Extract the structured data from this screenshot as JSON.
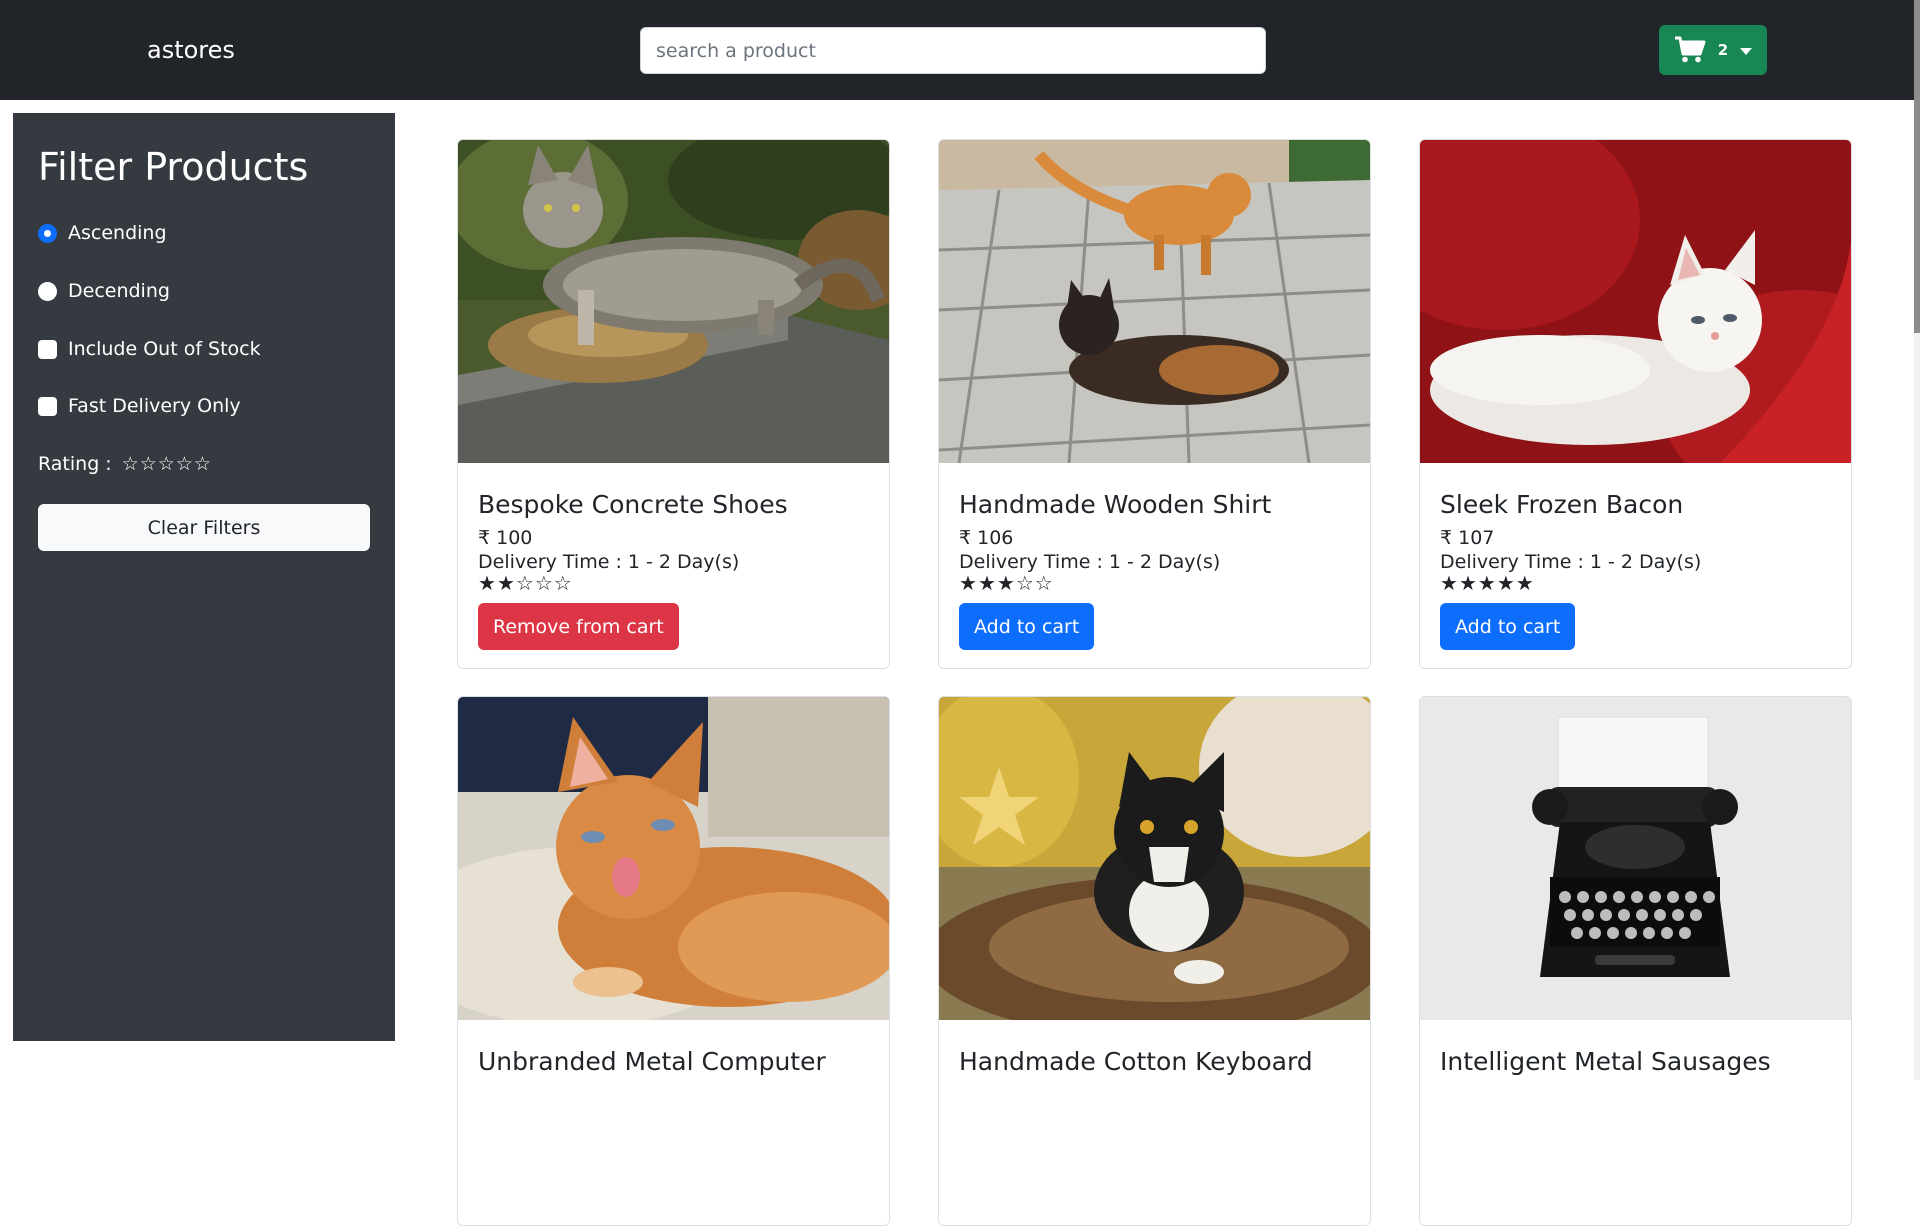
{
  "header": {
    "brand": "astores",
    "search_placeholder": "search a product",
    "cart_count": "2",
    "cart_icon": "cart-icon"
  },
  "sidebar": {
    "title": "Filter Products",
    "sort_options": [
      {
        "label": "Ascending",
        "checked": true
      },
      {
        "label": "Decending",
        "checked": false
      }
    ],
    "toggles": [
      {
        "label": "Include Out of Stock",
        "checked": false
      },
      {
        "label": "Fast Delivery Only",
        "checked": false
      }
    ],
    "rating_label": "Rating :",
    "rating_value": 0,
    "rating_max": 5,
    "clear_label": "Clear Filters"
  },
  "products": [
    {
      "name": "Bespoke Concrete Shoes",
      "price": "₹ 100",
      "delivery": "Delivery Time : 1 - 2 Day(s)",
      "rating": 2,
      "action": "Remove from cart",
      "action_color": "#dc3545",
      "image": "tabby-cat-in-planter"
    },
    {
      "name": "Handmade Wooden Shirt",
      "price": "₹ 106",
      "delivery": "Delivery Time : 1 - 2 Day(s)",
      "rating": 3,
      "action": "Add to cart",
      "action_color": "#0d6efd",
      "image": "two-cats-on-tiles"
    },
    {
      "name": "Sleek Frozen Bacon",
      "price": "₹ 107",
      "delivery": "Delivery Time : 1 - 2 Day(s)",
      "rating": 5,
      "action": "Add to cart",
      "action_color": "#0d6efd",
      "image": "white-kitten-on-red-pillow"
    },
    {
      "name": "Unbranded Metal Computer",
      "image": "orange-kitten-yawning"
    },
    {
      "name": "Handmade Cotton Keyboard",
      "image": "black-white-cat-on-fur"
    },
    {
      "name": "Intelligent Metal Sausages",
      "image": "black-typewriter"
    }
  ],
  "colors": {
    "navbar": "#212529",
    "sidebar": "#343a40",
    "cart_button": "#198754",
    "primary": "#0d6efd",
    "danger": "#dc3545"
  }
}
